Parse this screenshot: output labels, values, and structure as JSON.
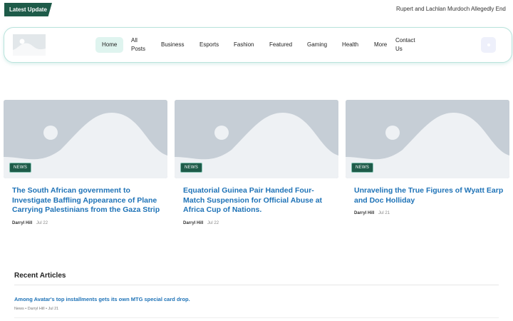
{
  "ticker": {
    "badge": "Latest Update",
    "headline": "Rupert and Lachlan Murdoch Allegedly End"
  },
  "nav": {
    "items": [
      "Home",
      "All Posts",
      "Business",
      "Esports",
      "Fashion",
      "Featured",
      "Gaming",
      "Health",
      "More",
      "Contact Us"
    ],
    "active": "Home"
  },
  "cards": [
    {
      "badge": "NEWS",
      "title": "The South African government to Investigate Baffling Appearance of Plane Carrying Palestinians from the Gaza Strip",
      "author": "Darryl Hill",
      "date": "Jul 22"
    },
    {
      "badge": "NEWS",
      "title": "Equatorial Guinea Pair Handed Four-Match Suspension for Official Abuse at Africa Cup of Nations.",
      "author": "Darryl Hill",
      "date": "Jul 22"
    },
    {
      "badge": "NEWS",
      "title": "Unraveling the True Figures of Wyatt Earp and Doc Holliday",
      "author": "Darryl Hill",
      "date": "Jul 21"
    }
  ],
  "recent": {
    "heading": "Recent Articles",
    "items": [
      {
        "title": "Among Avatar's top installments gets its own MTG special card drop.",
        "meta": "News • Darryl Hill • Jul 21"
      }
    ]
  }
}
